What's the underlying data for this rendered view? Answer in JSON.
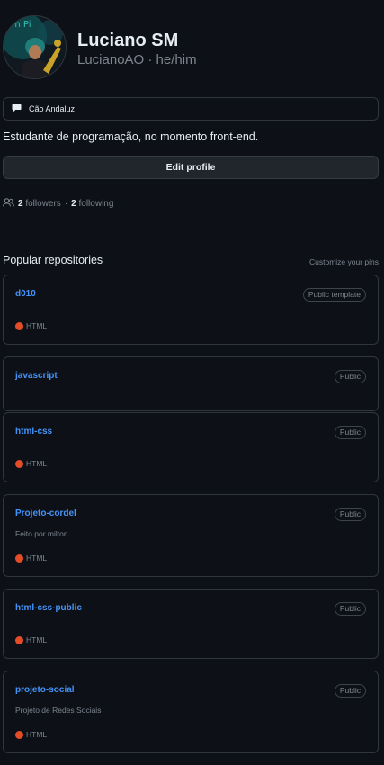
{
  "profile": {
    "name": "Luciano SM",
    "username": "LucianoAO · he/him",
    "status": "Cão Andaluz",
    "bio": "Estudante de programação, no momento front-end.",
    "edit_label": "Edit profile",
    "followers_count": "2",
    "followers_label": "followers",
    "separator": "·",
    "following_count": "2",
    "following_label": "following"
  },
  "popular": {
    "title": "Popular repositories",
    "customize_label": "Customize your pins"
  },
  "repos": [
    {
      "name": "d010",
      "badge": "Public template",
      "description": "",
      "language": "HTML",
      "lang_color": "#e34c26"
    },
    {
      "name": "javascript",
      "badge": "Public",
      "description": "",
      "language": "",
      "lang_color": ""
    },
    {
      "name": "html-css",
      "badge": "Public",
      "description": "",
      "language": "HTML",
      "lang_color": "#e34c26"
    },
    {
      "name": "Projeto-cordel",
      "badge": "Public",
      "description": "Feito por milton.",
      "language": "HTML",
      "lang_color": "#e34c26"
    },
    {
      "name": "html-css-public",
      "badge": "Public",
      "description": "",
      "language": "HTML",
      "lang_color": "#e34c26"
    },
    {
      "name": "projeto-social",
      "badge": "Public",
      "description": "Projeto de Redes Sociais",
      "language": "HTML",
      "lang_color": "#e34c26"
    }
  ],
  "icons": {
    "status": "speech-bubble-icon",
    "people": "people-icon"
  },
  "colors": {
    "background": "#0d1117",
    "link": "#4493f8",
    "muted": "#7d8590",
    "border": "#30363d"
  }
}
